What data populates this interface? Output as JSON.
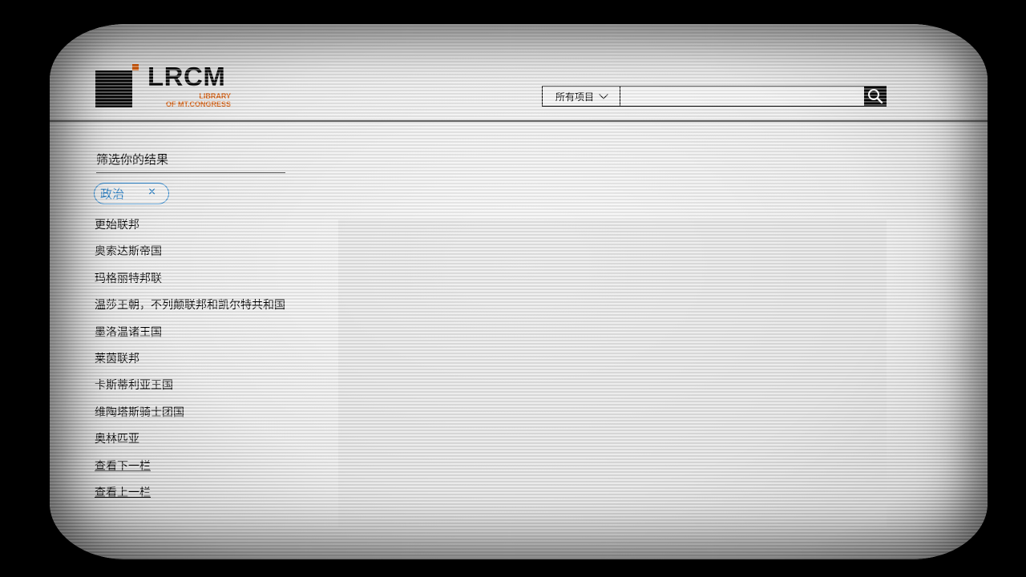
{
  "logo": {
    "name": "LRCM",
    "subtitle_line1": "LIBRARY",
    "subtitle_line2": "OF MT.CONGRESS"
  },
  "search": {
    "scope_selected": "所有项目",
    "query": "",
    "placeholder": ""
  },
  "sidebar": {
    "title": "筛选你的结果",
    "active_filter": "政治",
    "remove_icon": "×",
    "results": [
      "更始联邦",
      "奥索达斯帝国",
      "玛格丽特邦联",
      "温莎王朝，不列颠联邦和凯尔特共和国",
      "墨洛温诸王国",
      "莱茵联邦",
      "卡斯蒂利亚王国",
      "维陶塔斯骑士团国",
      "奥林匹亚"
    ],
    "next_page": "查看下一栏",
    "prev_page": "查看上一栏"
  },
  "colors": {
    "brand_orange": "#d35400",
    "filter_blue": "#1b78c2"
  }
}
